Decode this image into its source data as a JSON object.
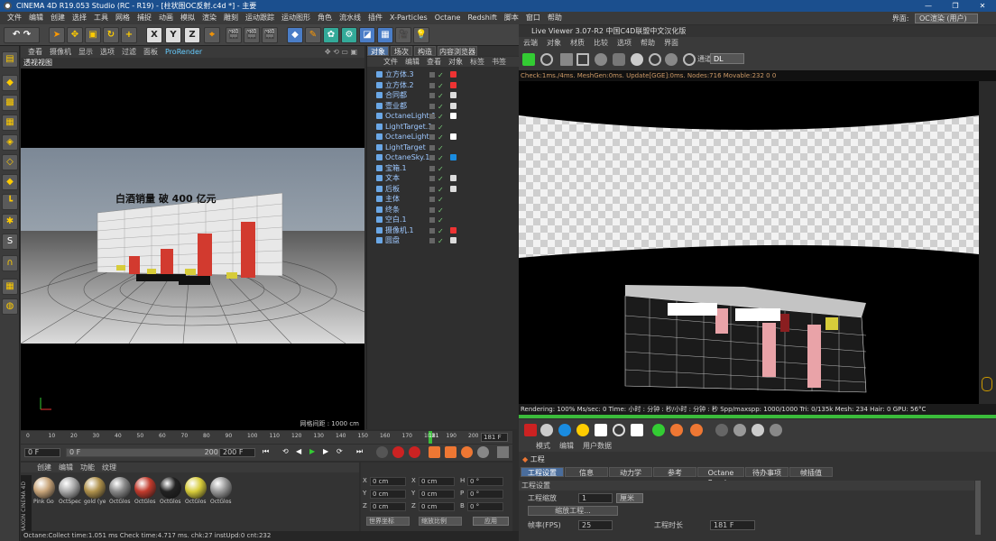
{
  "window": {
    "title": "CINEMA 4D R19.053 Studio (RC - R19) - [柱状图OC反射.c4d *] - 主要"
  },
  "menu": [
    "文件",
    "编辑",
    "创建",
    "选择",
    "工具",
    "网格",
    "捕捉",
    "动画",
    "模拟",
    "渲染",
    "雕刻",
    "运动跟踪",
    "运动图形",
    "角色",
    "流水线",
    "插件",
    "X-Particles",
    "Octane",
    "Redshift",
    "脚本",
    "窗口",
    "帮助"
  ],
  "interface": {
    "label": "界面:",
    "value": "OC渲染 (用户)"
  },
  "toolbar": {
    "x": "X",
    "y": "Y",
    "z": "Z"
  },
  "viewport": {
    "menu": [
      "查看",
      "摄像机",
      "显示",
      "选项",
      "过滤",
      "面板",
      "ProRender"
    ],
    "title": "透视视图",
    "headline": "白酒销量 破 400 亿元",
    "grid_distance": "网格间距 : 1000 cm"
  },
  "objects": {
    "tabs": [
      "对象",
      "场次",
      "构造",
      "内容浏览器"
    ],
    "menu": [
      "文件",
      "编辑",
      "查看",
      "对象",
      "标签",
      "书签"
    ],
    "items": [
      {
        "name": "立方体.3",
        "tag": "#e33"
      },
      {
        "name": "立方体.2",
        "tag": "#e33"
      },
      {
        "name": "合同都",
        "tag": "#ddd"
      },
      {
        "name": "壹业都",
        "tag": "#ddd"
      },
      {
        "name": "OctaneLight.1",
        "tag": "#fff"
      },
      {
        "name": "LightTarget.1",
        "tag": ""
      },
      {
        "name": "OctaneLight",
        "tag": "#fff"
      },
      {
        "name": "LightTarget",
        "tag": ""
      },
      {
        "name": "OctaneSky.1",
        "tag": "#1a8ce0"
      },
      {
        "name": "宝箱.1",
        "tag": ""
      },
      {
        "name": "文本",
        "tag": "#ddd"
      },
      {
        "name": "后板",
        "tag": "#ddd"
      },
      {
        "name": "主体",
        "tag": ""
      },
      {
        "name": "终条",
        "tag": ""
      },
      {
        "name": "空白.1",
        "tag": ""
      },
      {
        "name": "摄像机.1",
        "tag": "#e33"
      },
      {
        "name": "圆盘",
        "tag": "#ddd"
      }
    ]
  },
  "timeline": {
    "ticks": [
      "0",
      "10",
      "20",
      "30",
      "40",
      "50",
      "60",
      "70",
      "80",
      "90",
      "100",
      "110",
      "120",
      "130",
      "140",
      "150",
      "160",
      "170",
      "180",
      "190",
      "200"
    ],
    "current": "181",
    "end": "181 F",
    "start_field": "0 F",
    "range_start": "0 F",
    "range_end": "200 F",
    "max_field": "200 F"
  },
  "materials": {
    "menu": [
      "创建",
      "编辑",
      "功能",
      "纹理"
    ],
    "items": [
      {
        "name": "Pink Go",
        "color": "#c9a57a"
      },
      {
        "name": "OctSpec",
        "color": "#aaa"
      },
      {
        "name": "gold (ye",
        "color": "#b0924c"
      },
      {
        "name": "OctGlos",
        "color": "#888"
      },
      {
        "name": "OctGlos",
        "color": "#c23b2d"
      },
      {
        "name": "OctGlos",
        "color": "#222"
      },
      {
        "name": "OctGlos",
        "color": "#d7cc3a"
      },
      {
        "name": "OctGlos",
        "color": "#999"
      }
    ]
  },
  "coords": {
    "labels": [
      "X",
      "Y",
      "Z"
    ],
    "pos": [
      "0 cm",
      "0 cm",
      "0 cm"
    ],
    "size": [
      "0 cm",
      "0 cm",
      "0 cm"
    ],
    "rot_labels": [
      "H",
      "P",
      "B"
    ],
    "rot": [
      "0 °",
      "0 °",
      "0 °"
    ],
    "mode1": "世界坐标",
    "mode2": "缩放比例",
    "apply": "应用"
  },
  "liveviewer": {
    "title": "Live Viewer 3.07-R2 中国C4D联盟中文汉化版",
    "menu": [
      "云端",
      "对象",
      "材质",
      "比较",
      "选项",
      "帮助",
      "界面"
    ],
    "channel_label": "通道:",
    "channel_value": "DL",
    "status": "Check:1ms./4ms. MeshGen:0ms. Update[GGE]:0ms. Nodes:716 Movable:232 0 0",
    "render_info": "Rendering: 100%   Ms/sec: 0   Time: 小时 : 分钟 : 秒/小时 : 分钟 : 秒   Spp/maxspp: 1000/1000   Tri: 0/135k   Mesh: 234   Hair: 0   GPU:   56°C"
  },
  "attributes": {
    "menu": [
      "模式",
      "编辑",
      "用户数据"
    ],
    "section": "工程",
    "tabs": [
      "工程设置",
      "信息",
      "动力学",
      "参考",
      "Octane Render",
      "待办事项",
      "帧插值"
    ],
    "group": "工程设置",
    "scale_label": "工程缩放",
    "scale_value": "1",
    "scale_unit": "厘米",
    "scale_btn": "缩放工程...",
    "fps_label": "帧率(FPS)",
    "fps_value": "25",
    "length_label": "工程时长",
    "length_value": "181 F"
  },
  "statusbar": {
    "text": "Octane:Collect time:1.051 ms  Check time:4.717 ms.  chk:27  instUpd:0  cnt:232"
  },
  "colors": {
    "accent": "#4a6d9c",
    "bar_red": "#d23a2f",
    "green": "#3bbc3b",
    "title_blue": "#1b4f8e"
  }
}
